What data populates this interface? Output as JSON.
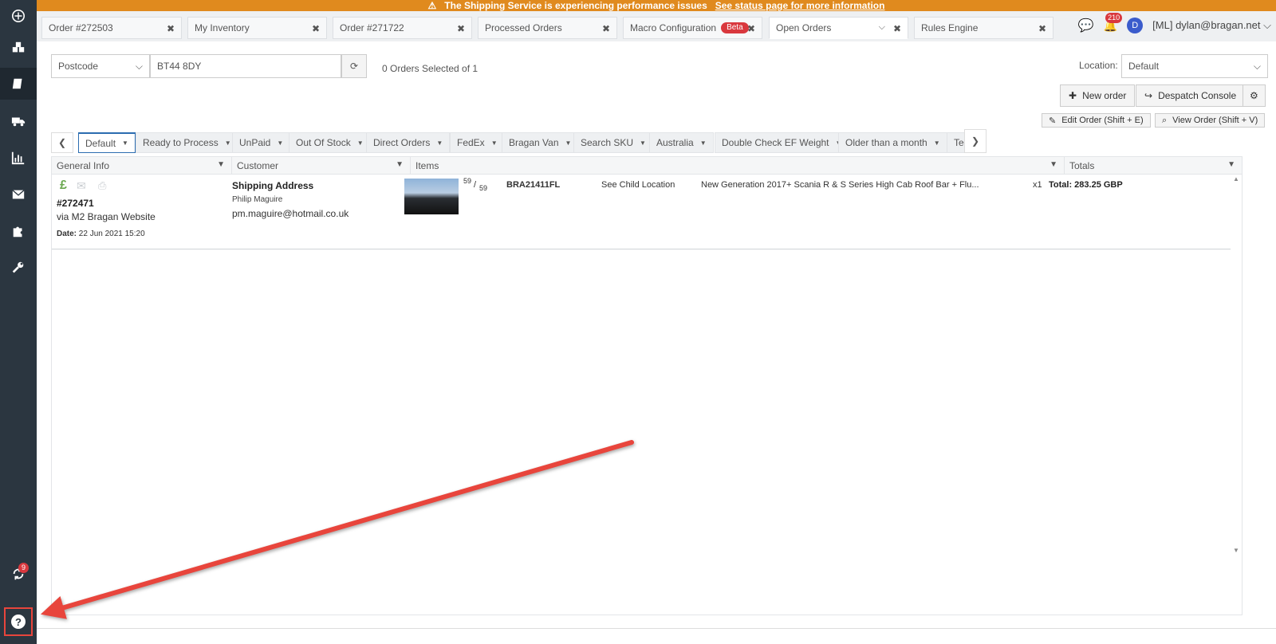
{
  "banner": {
    "warning_icon": "warning-icon",
    "message": "The Shipping Service is experiencing performance issues",
    "link": "See status page for more information"
  },
  "tabs": [
    {
      "label": "Order #272503"
    },
    {
      "label": "My Inventory"
    },
    {
      "label": "Order #271722"
    },
    {
      "label": "Processed Orders"
    },
    {
      "label": "Macro Configuration",
      "badge": "Beta"
    },
    {
      "label": "Open Orders",
      "active": true
    },
    {
      "label": "Rules Engine"
    }
  ],
  "header": {
    "notifications_count": "210",
    "avatar_initial": "D",
    "user": "[ML] dylan@bragan.net"
  },
  "search": {
    "field_select": "Postcode",
    "query": "BT44 8DY",
    "selection_status": "0 Orders Selected of 1"
  },
  "location": {
    "label": "Location:",
    "value": "Default"
  },
  "actions": {
    "new_order": "New order",
    "despatch_console": "Despatch Console",
    "edit_order": "Edit Order (Shift + E)",
    "view_order": "View Order (Shift + V)"
  },
  "filters": [
    "Default",
    "Ready to Process",
    "UnPaid",
    "Out Of Stock",
    "Direct Orders",
    "FedEx",
    "Bragan Van",
    "Search SKU",
    "Australia",
    "Double Check EF Weight",
    "Older than a month",
    "Te"
  ],
  "columns": [
    "General Info",
    "Customer",
    "Items",
    "Totals"
  ],
  "order": {
    "number": "#272471",
    "channel": "via M2 Bragan Website",
    "date_label": "Date:",
    "date": "22 Jun 2021 15:20",
    "address_title": "Shipping Address",
    "customer_name": "Philip Maguire",
    "email": "pm.maguire@hotmail.co.uk",
    "stock_top": "59",
    "stock_sep": "/",
    "stock_bottom": "59",
    "sku": "BRA21411FL",
    "location": "See Child Location",
    "description": "New Generation 2017+ Scania R & S Series High Cab Roof Bar + Flu...",
    "qty": "x1",
    "total": "Total: 283.25 GBP"
  },
  "sidebar": {
    "sync_count": "9",
    "help": "?"
  },
  "colors": {
    "banner": "#e08a1e",
    "sidebar": "#2b3640",
    "badge": "#d9383e",
    "annotation_arrow": "#e8453c"
  }
}
